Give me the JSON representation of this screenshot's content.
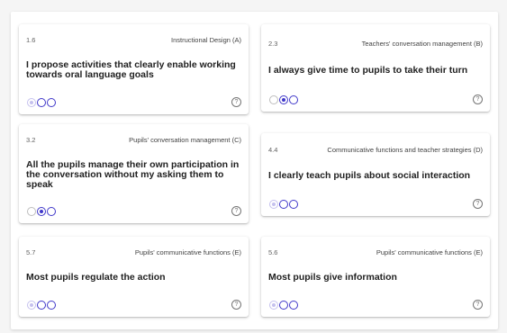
{
  "cards": [
    {
      "number": "1.6",
      "category": "Instructional Design (A)",
      "question": "I propose activities that clearly enable working towards oral language goals",
      "help_icon": "?"
    },
    {
      "number": "2.3",
      "category": "Teachers' conversation management (B)",
      "question": "I always give time to pupils to take their turn",
      "help_icon": "?"
    },
    {
      "number": "3.2",
      "category": "Pupils' conversation management (C)",
      "question": "All the pupils manage their own participation in the conversation without my asking them to speak",
      "help_icon": "?"
    },
    {
      "number": "4.4",
      "category": "Communicative functions and teacher strategies (D)",
      "question": "I clearly teach pupils about social interaction",
      "help_icon": "?"
    },
    {
      "number": "5.7",
      "category": "Pupils' communicative functions (E)",
      "question": "Most pupils regulate the action",
      "help_icon": "?"
    },
    {
      "number": "5.6",
      "category": "Pupils' communicative functions (E)",
      "question": "Most pupils give information",
      "help_icon": "?"
    }
  ],
  "colors": {
    "accent": "#3f37c9",
    "disabled": "#c5c1ee"
  }
}
